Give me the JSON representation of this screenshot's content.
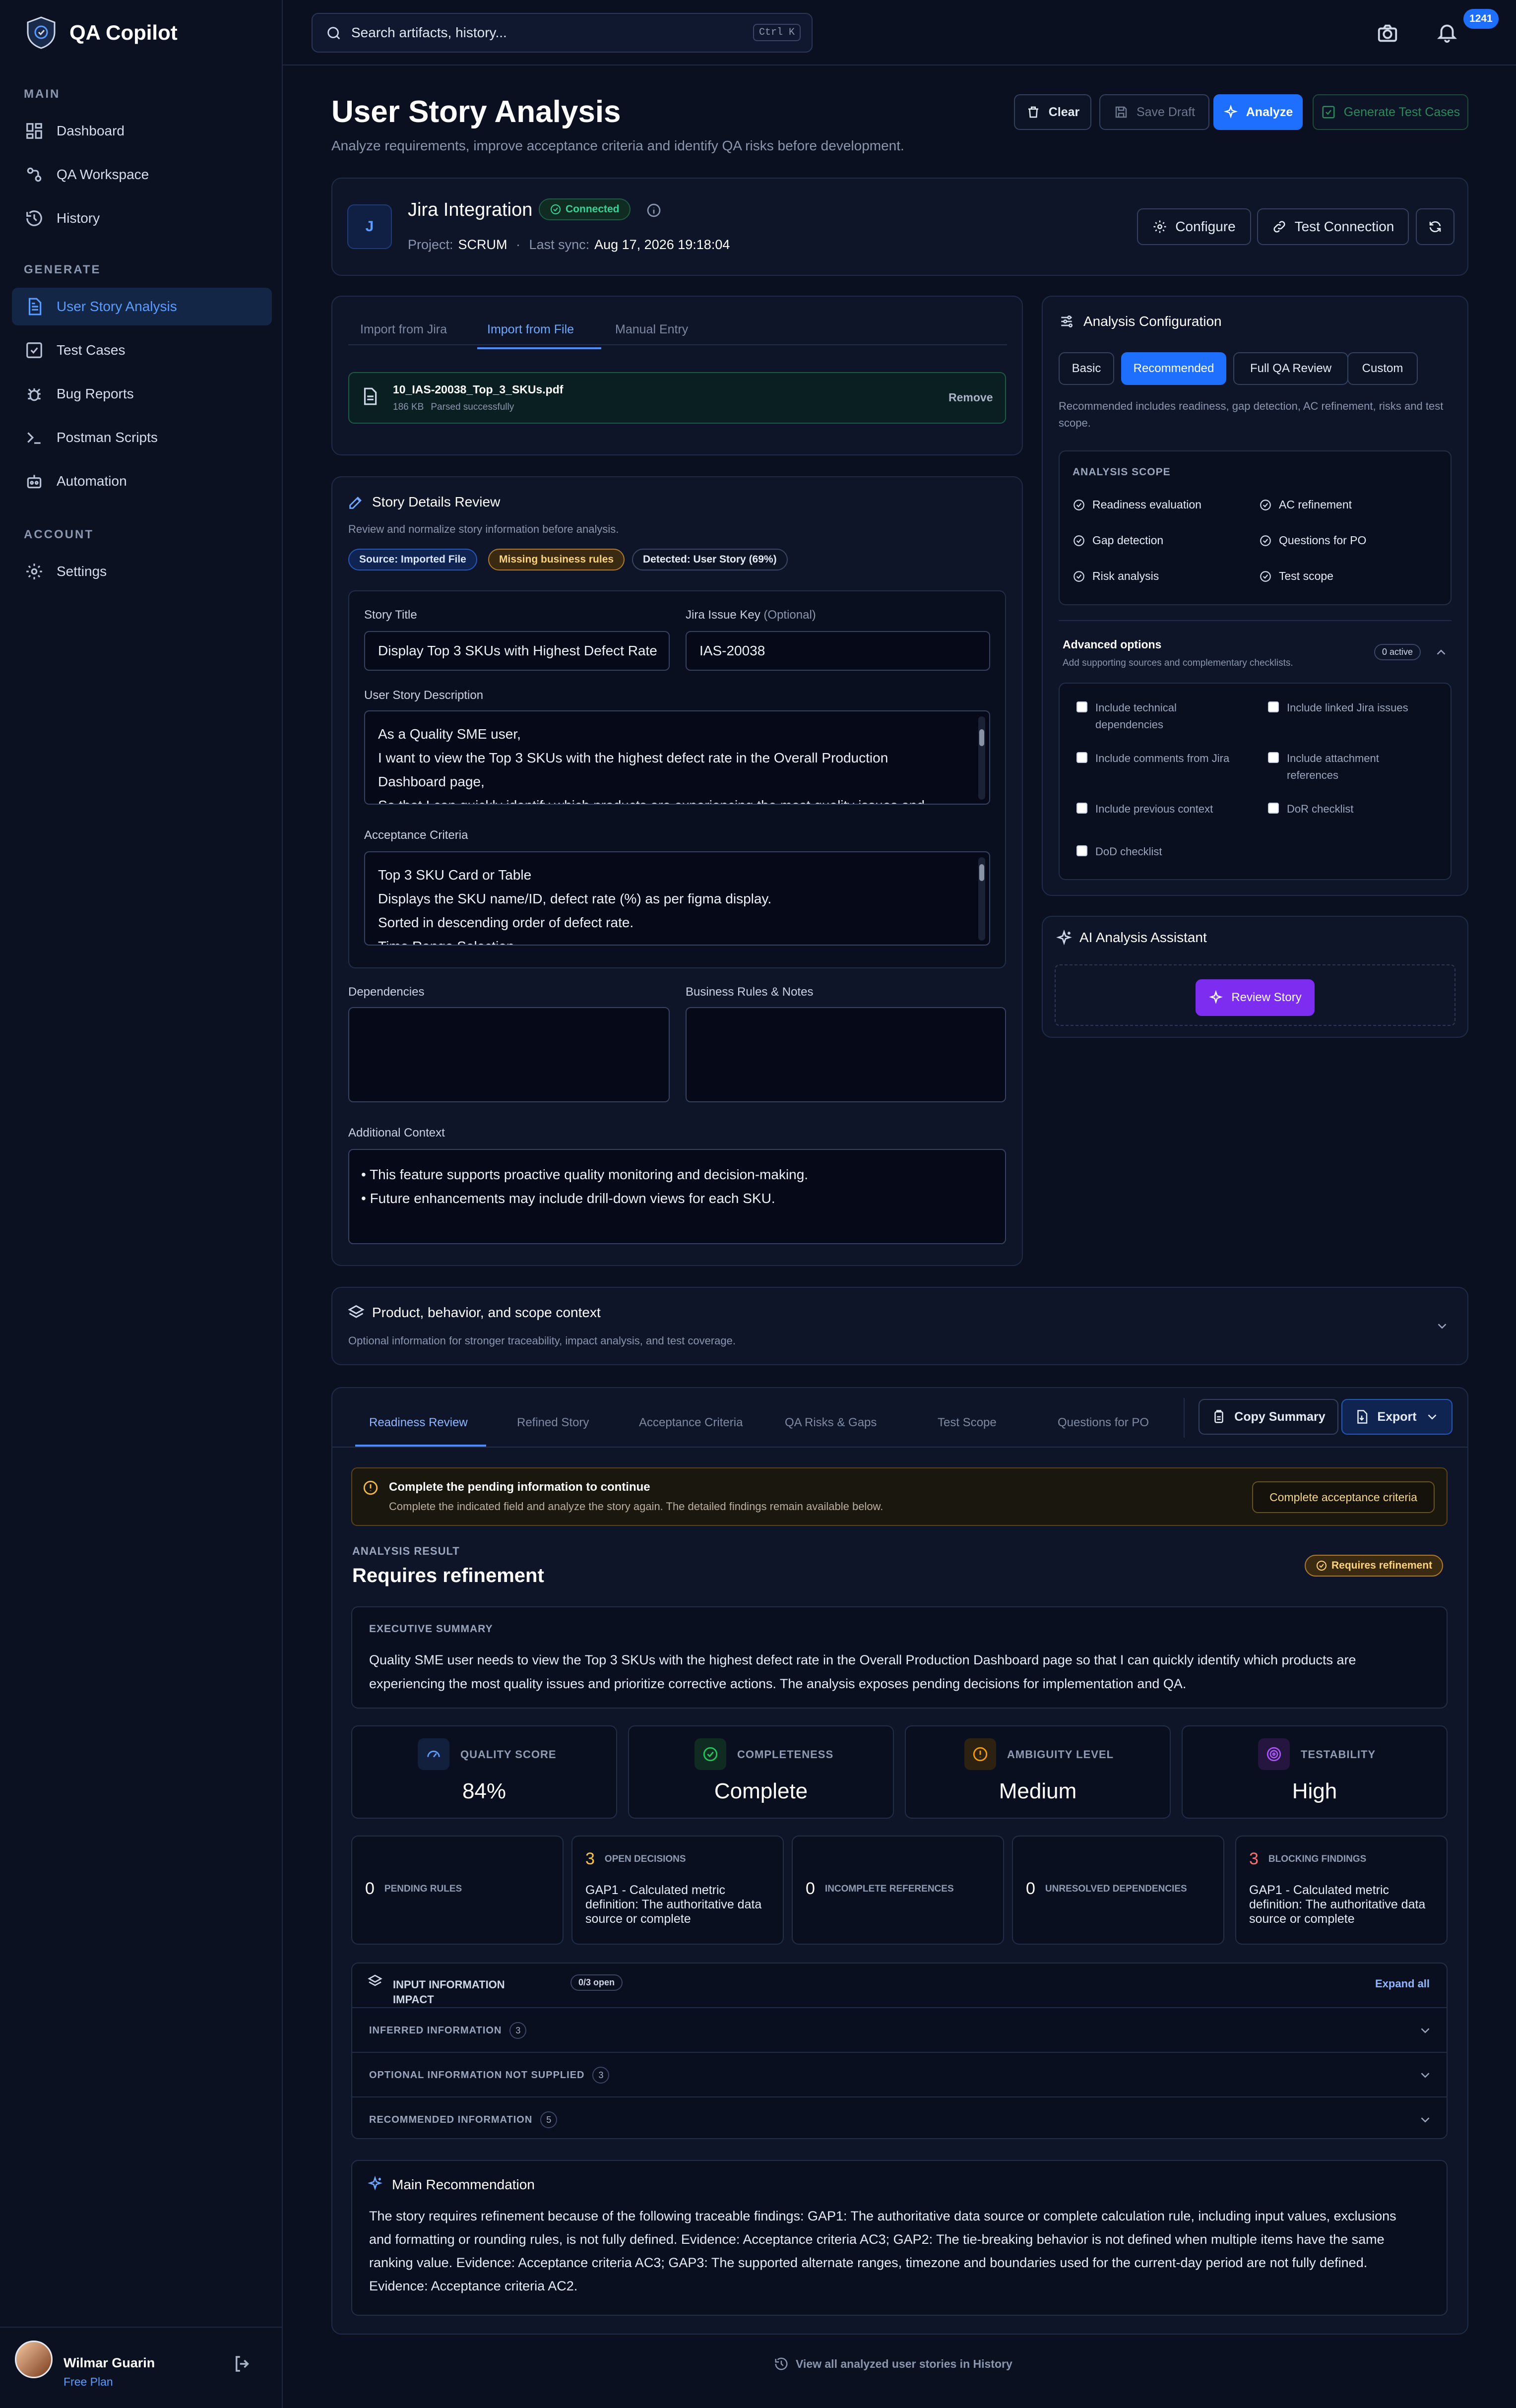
{
  "app": {
    "name": "QA Copilot"
  },
  "search": {
    "placeholder": "Search artifacts, history...",
    "shortcut": "Ctrl K"
  },
  "notifications": {
    "count": "1241"
  },
  "sidebar": {
    "main_label": "MAIN",
    "main": [
      {
        "label": "Dashboard",
        "icon": "dashboard-icon"
      },
      {
        "label": "QA Workspace",
        "icon": "workspace-icon"
      },
      {
        "label": "History",
        "icon": "history-icon"
      }
    ],
    "generate_label": "GENERATE",
    "generate": [
      {
        "label": "User Story Analysis",
        "icon": "document-icon",
        "active": true
      },
      {
        "label": "Test Cases",
        "icon": "checklist-icon"
      },
      {
        "label": "Bug Reports",
        "icon": "bug-icon"
      },
      {
        "label": "Postman Scripts",
        "icon": "terminal-icon"
      },
      {
        "label": "Automation",
        "icon": "robot-icon"
      }
    ],
    "account_label": "ACCOUNT",
    "account": [
      {
        "label": "Settings",
        "icon": "gear-icon"
      }
    ],
    "user": {
      "name": "Wilmar Guarin",
      "plan": "Free Plan"
    }
  },
  "page": {
    "title": "User Story Analysis",
    "subtitle": "Analyze requirements, improve acceptance criteria and identify QA risks before development.",
    "actions": {
      "clear": "Clear",
      "save_draft": "Save Draft",
      "analyze": "Analyze",
      "generate": "Generate Test Cases"
    }
  },
  "jira": {
    "avatar": "J",
    "title": "Jira Integration",
    "status": "Connected",
    "project_label": "Project:",
    "project": "SCRUM",
    "sync_label": "Last sync:",
    "sync": "Aug 17, 2026 19:18:04",
    "configure": "Configure",
    "test_connection": "Test Connection"
  },
  "import": {
    "tabs": [
      "Import from Jira",
      "Import from File",
      "Manual Entry"
    ],
    "active_tab": 1,
    "file_name": "10_IAS-20038_Top_3_SKUs.pdf",
    "file_size": "186 KB",
    "file_status": "Parsed successfully",
    "remove": "Remove"
  },
  "story": {
    "title": "Story Details Review",
    "subtitle": "Review and normalize story information before analysis.",
    "tags": {
      "source": "Source: Imported File",
      "missing": "Missing business rules",
      "detected": "Detected: User Story (69%)"
    },
    "story_title_label": "Story Title",
    "story_title_value": "Display Top 3 SKUs with Highest Defect Rate",
    "issue_key_label": "Jira Issue Key",
    "issue_key_optional": "(Optional)",
    "issue_key_value": "IAS-20038",
    "description_label": "User Story Description",
    "description_lines": [
      "As a Quality SME user,",
      "I want to view the Top 3 SKUs with the highest defect rate in the Overall Production",
      "Dashboard page,",
      "So that I can quickly identify which products are experiencing the most quality issues and"
    ],
    "ac_label": "Acceptance Criteria",
    "ac_lines": [
      "Top 3 SKU Card or Table",
      "Displays the SKU name/ID, defect rate (%) as per figma display.",
      "Sorted in descending order of defect rate.",
      "Time Range Selection"
    ],
    "dependencies_label": "Dependencies",
    "business_rules_label": "Business Rules & Notes",
    "context_label": "Additional Context",
    "context_lines": [
      "• This feature supports proactive quality monitoring and decision-making.",
      "• Future enhancements may include drill-down views for each SKU."
    ]
  },
  "config": {
    "title": "Analysis Configuration",
    "presets": [
      "Basic",
      "Recommended",
      "Full QA Review",
      "Custom"
    ],
    "active_preset": 1,
    "description": "Recommended includes readiness, gap detection, AC refinement, risks and test scope.",
    "scope_title": "ANALYSIS SCOPE",
    "scope": [
      "Readiness evaluation",
      "AC refinement",
      "Gap detection",
      "Questions for PO",
      "Risk analysis",
      "Test scope"
    ],
    "advanced_title": "Advanced options",
    "advanced_sub": "Add supporting sources and complementary checklists.",
    "advanced_badge": "0 active",
    "options": [
      {
        "label": "Include technical dependencies"
      },
      {
        "label": "Include linked Jira issues"
      },
      {
        "label": "Include comments from Jira"
      },
      {
        "label": "Include attachment references"
      },
      {
        "label": "Include previous context"
      },
      {
        "label": "DoR checklist"
      },
      {
        "label": "DoD checklist"
      }
    ]
  },
  "assistant": {
    "title": "AI Analysis Assistant",
    "button": "Review Story"
  },
  "context_section": {
    "title": "Product, behavior, and scope context",
    "subtitle": "Optional information for stronger traceability, impact analysis, and test coverage."
  },
  "results": {
    "tabs": [
      "Readiness Review",
      "Refined Story",
      "Acceptance Criteria",
      "QA Risks & Gaps",
      "Test Scope",
      "Questions for PO"
    ],
    "active_tab": 0,
    "copy_summary": "Copy Summary",
    "export": "Export",
    "alert_title": "Complete the pending information to continue",
    "alert_text": "Complete the indicated field and analyze the story again. The detailed findings remain available below.",
    "alert_button": "Complete acceptance criteria",
    "result_label": "ANALYSIS RESULT",
    "result_value": "Requires refinement",
    "result_badge": "Requires refinement",
    "exec_label": "EXECUTIVE SUMMARY",
    "exec_lines": [
      "Quality SME user needs to view the Top 3 SKUs with the highest defect rate in the Overall Production Dashboard page so that I can quickly identify which products are",
      "experiencing the most quality issues and prioritize corrective actions. The analysis exposes pending decisions for implementation and QA."
    ],
    "metrics": [
      {
        "label": "QUALITY SCORE",
        "value": "84%",
        "icon": "gauge-icon",
        "color": "#5b9cff"
      },
      {
        "label": "COMPLETENESS",
        "value": "Complete",
        "icon": "check-circle-icon",
        "color": "#22c55e"
      },
      {
        "label": "AMBIGUITY LEVEL",
        "value": "Medium",
        "icon": "alert-icon",
        "color": "#f59e0b"
      },
      {
        "label": "TESTABILITY",
        "value": "High",
        "icon": "target-icon",
        "color": "#a855f7"
      }
    ],
    "counters": [
      {
        "count": "0",
        "label": "PENDING RULES",
        "detail": ""
      },
      {
        "count": "3",
        "label": "OPEN DECISIONS",
        "detail": "GAP1 - Calculated metric definition: The authoritative data source or complete",
        "color": "#f5c542"
      },
      {
        "count": "0",
        "label": "INCOMPLETE REFERENCES",
        "detail": ""
      },
      {
        "count": "0",
        "label": "UNRESOLVED DEPENDENCIES",
        "detail": ""
      },
      {
        "count": "3",
        "label": "BLOCKING FINDINGS",
        "detail": "GAP1 - Calculated metric definition: The authoritative data source or complete",
        "color": "#f87171"
      }
    ],
    "impact": {
      "title": "INPUT INFORMATION IMPACT",
      "badge": "0/3 open",
      "expand": "Expand all",
      "rows": [
        {
          "label": "INFERRED INFORMATION",
          "count": "3"
        },
        {
          "label": "OPTIONAL INFORMATION NOT SUPPLIED",
          "count": "3"
        },
        {
          "label": "RECOMMENDED INFORMATION",
          "count": "5"
        }
      ]
    },
    "recommendation": {
      "title": "Main Recommendation",
      "lines": [
        "The story requires refinement because of the following traceable findings: GAP1: The authoritative data source or complete calculation rule, including input values, exclusions",
        "and formatting or rounding rules, is not fully defined. Evidence: Acceptance criteria AC3; GAP2: The tie-breaking behavior is not defined when multiple items have the same",
        "ranking value. Evidence: Acceptance criteria AC3; GAP3: The supported alternate ranges, timezone and boundaries used for the current-day period are not fully defined.",
        "Evidence: Acceptance criteria AC2."
      ]
    },
    "history_link": "View all analyzed user stories in History"
  }
}
